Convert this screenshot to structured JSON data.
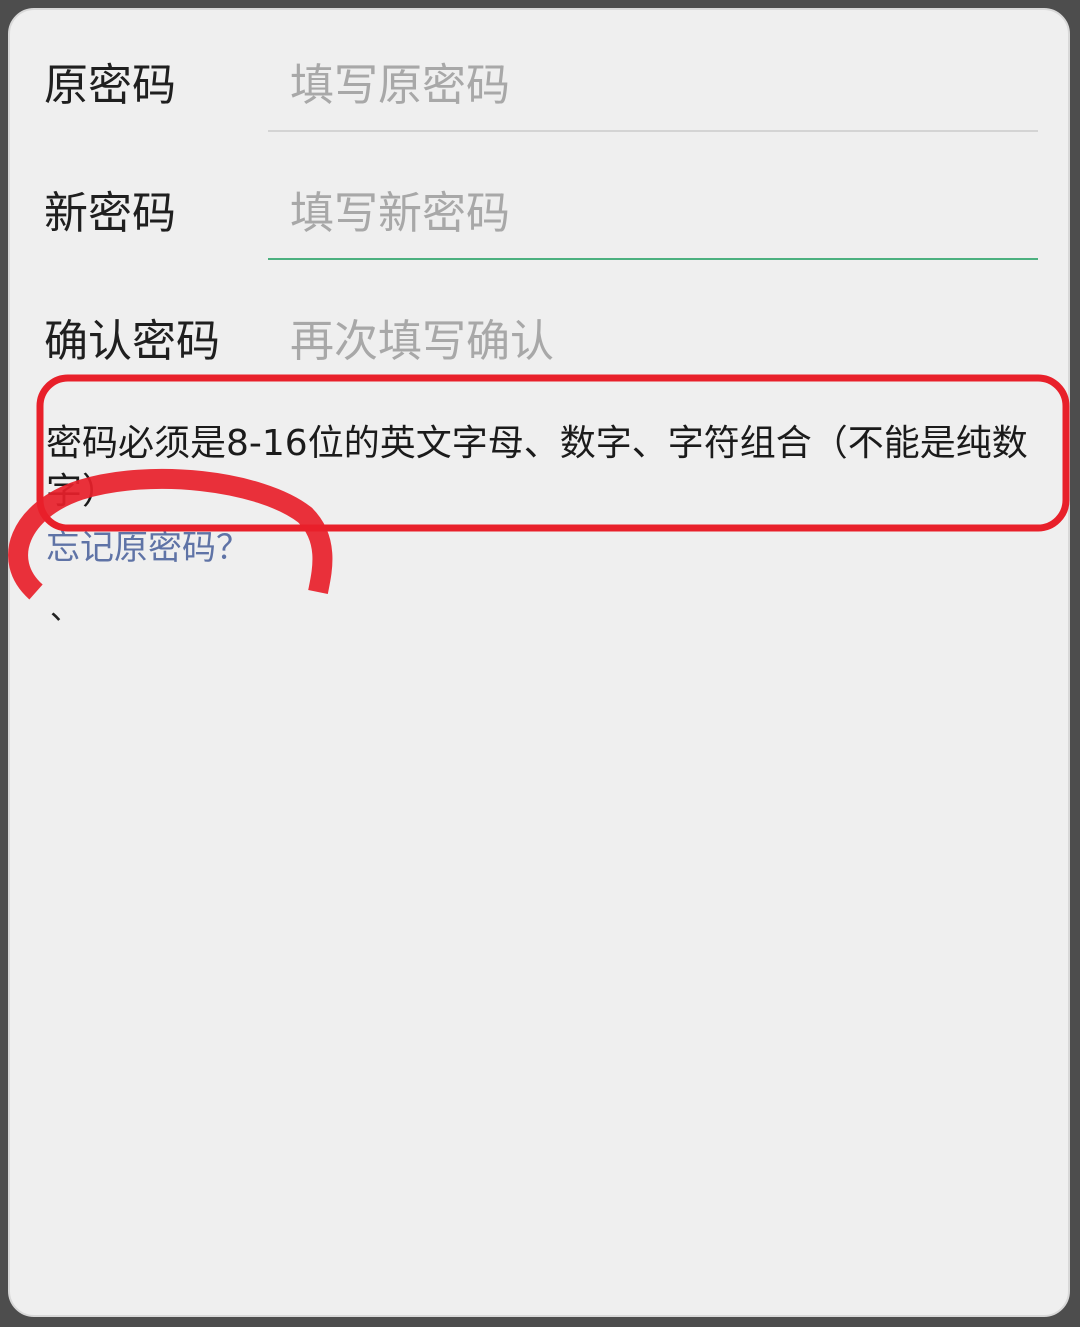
{
  "form": {
    "old_password": {
      "label": "原密码",
      "placeholder": "填写原密码",
      "value": ""
    },
    "new_password": {
      "label": "新密码",
      "placeholder": "填写新密码",
      "value": ""
    },
    "confirm_password": {
      "label": "确认密码",
      "placeholder": "再次填写确认",
      "value": ""
    }
  },
  "hint": "密码必须是8-16位的英文字母、数字、字符组合（不能是纯数字）",
  "forgot_link": "忘记原密码？",
  "stray_mark": "、",
  "colors": {
    "focus_underline": "#4cb07f",
    "link": "#5f73a6",
    "annotation_red": "#e8202a"
  }
}
